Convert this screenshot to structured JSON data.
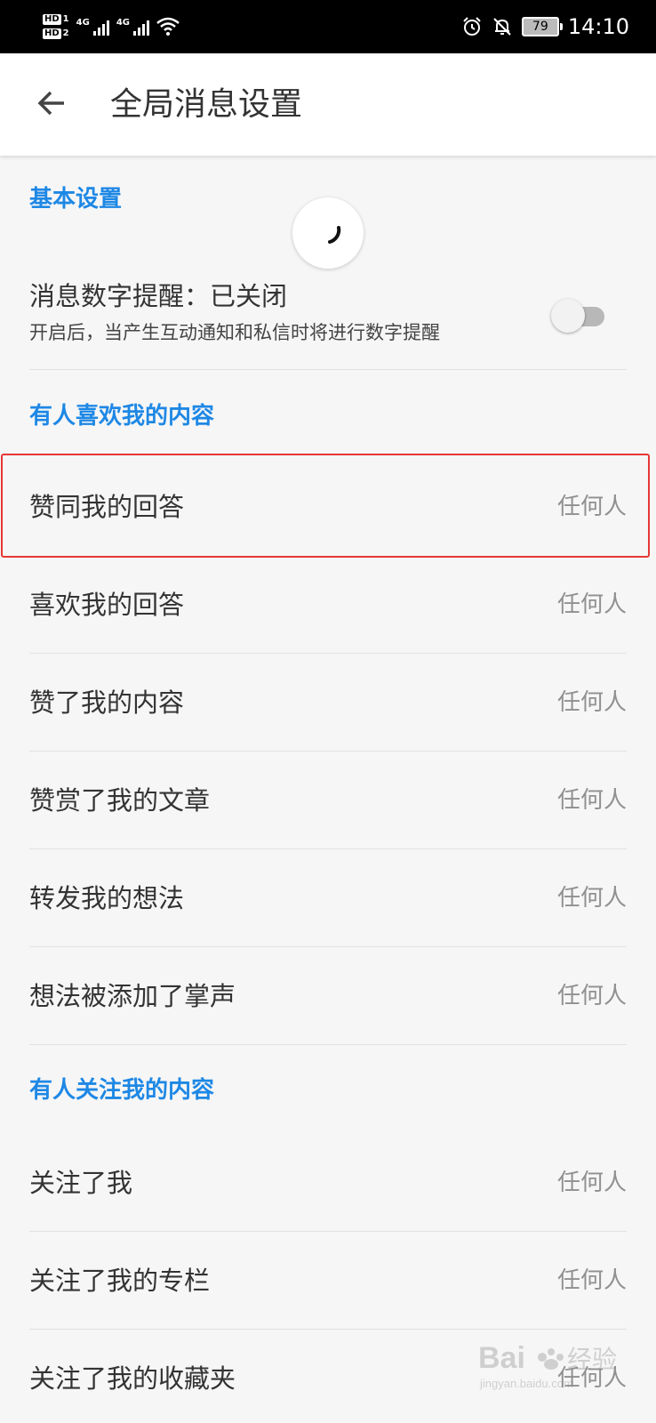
{
  "status_bar": {
    "sim1": "HD",
    "sim1_num": "1",
    "sim2": "HD",
    "sim2_num": "2",
    "net1": "4G",
    "net2": "4G",
    "battery": "79",
    "time": "14:10",
    "icons": [
      "signal-icon",
      "wifi-icon",
      "alarm-icon",
      "mute-icon",
      "battery-icon"
    ]
  },
  "header": {
    "title": "全局消息设置",
    "back_icon": "arrow-left-icon"
  },
  "sections": {
    "basic": {
      "title": "基本设置",
      "toggle_title": "消息数字提醒：已关闭",
      "toggle_desc": "开启后，当产生互动通知和私信时将进行数字提醒",
      "toggle_on": false
    },
    "likes": {
      "title": "有人喜欢我的内容",
      "items": [
        {
          "label": "赞同我的回答",
          "value": "任何人"
        },
        {
          "label": "喜欢我的回答",
          "value": "任何人"
        },
        {
          "label": "赞了我的内容",
          "value": "任何人"
        },
        {
          "label": "赞赏了我的文章",
          "value": "任何人"
        },
        {
          "label": "转发我的想法",
          "value": "任何人"
        },
        {
          "label": "想法被添加了掌声",
          "value": "任何人"
        }
      ]
    },
    "follows": {
      "title": "有人关注我的内容",
      "items": [
        {
          "label": "关注了我",
          "value": "任何人"
        },
        {
          "label": "关注了我的专栏",
          "value": "任何人"
        },
        {
          "label": "关注了我的收藏夹",
          "value": "任何人"
        }
      ]
    }
  },
  "watermark": {
    "text": "Bai  经验",
    "sub": "jingyan.baidu.com"
  },
  "colors": {
    "accent": "#1e88e5",
    "highlight": "#e53935",
    "secondary_text": "#909090"
  }
}
